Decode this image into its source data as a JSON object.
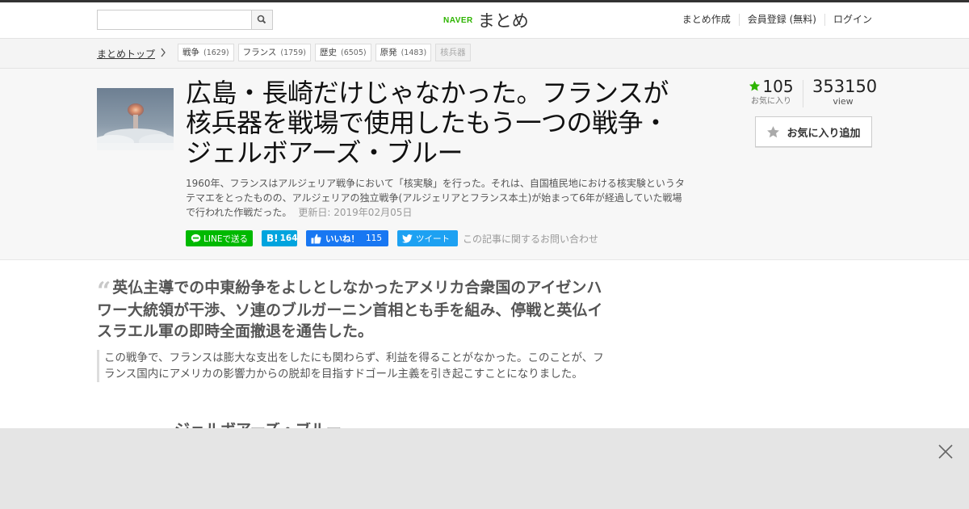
{
  "header": {
    "search_placeholder": "",
    "logo_brand": "NAVER",
    "logo_name": "まとめ",
    "nav": [
      "まとめ作成",
      "会員登録 (無料)",
      "ログイン"
    ]
  },
  "breadcrumb": {
    "home": "まとめトップ",
    "tags": [
      {
        "label": "戦争",
        "count": "(1629)"
      },
      {
        "label": "フランス",
        "count": "(1759)"
      },
      {
        "label": "歴史",
        "count": "(6505)"
      },
      {
        "label": "原発",
        "count": "(1483)"
      },
      {
        "label": "核兵器",
        "count": ""
      }
    ]
  },
  "article": {
    "title": "広島・長崎だけじゃなかった。フランスが核兵器を戦場で使用したもう一つの戦争・ジェルボアーズ・ブルー",
    "description": "1960年、フランスはアルジェリア戦争において「核実験」を行った。それは、自国植民地における核実験というタテマエをとったものの、アルジェリアの独立戦争(アルジェリアとフランス本土)が始まって6年が経過していた戦場で行われた作戦だった。",
    "updated": "更新日: 2019年02月05日",
    "favorites": "105",
    "favorites_label": "お気に入り",
    "views": "353150",
    "views_label": "view",
    "fav_button": "お気に入り追加"
  },
  "social": {
    "line": "LINEで送る",
    "hatena_count": "164",
    "like_label": "いいね！",
    "like_count": "115",
    "tweet": "ツイート",
    "inquiry": "この記事に関するお問い合わせ"
  },
  "content": {
    "quote_heading": "英仏主導での中東紛争をよしとしなかったアメリカ合衆国のアイゼンハワー大統領が干渉、ソ連のブルガーニン首相とも手を組み、停戦と英仏イスラエル軍の即時全面撤退を通告した。",
    "quote_body": "この戦争で、フランスは膨大な支出をしたにも関わらず、利益を得ることがなかった。このことが、フランス国内にアメリカの影響力からの脱却を目指すドゴール主義を引き起こすことになりました。",
    "next_heading": "ジェルボアーズ・ブルー"
  },
  "colors": {
    "brand_green": "#2db400",
    "line_green": "#00b900",
    "hatena_blue": "#00a4de",
    "facebook_blue": "#1877f2",
    "twitter_blue": "#1da1f2",
    "star_green": "#2db400"
  },
  "icons": [
    "search-icon",
    "chevron-right-icon",
    "star-icon",
    "quote-icon",
    "close-icon",
    "line-icon",
    "thumbs-up-icon",
    "twitter-bird-icon"
  ]
}
